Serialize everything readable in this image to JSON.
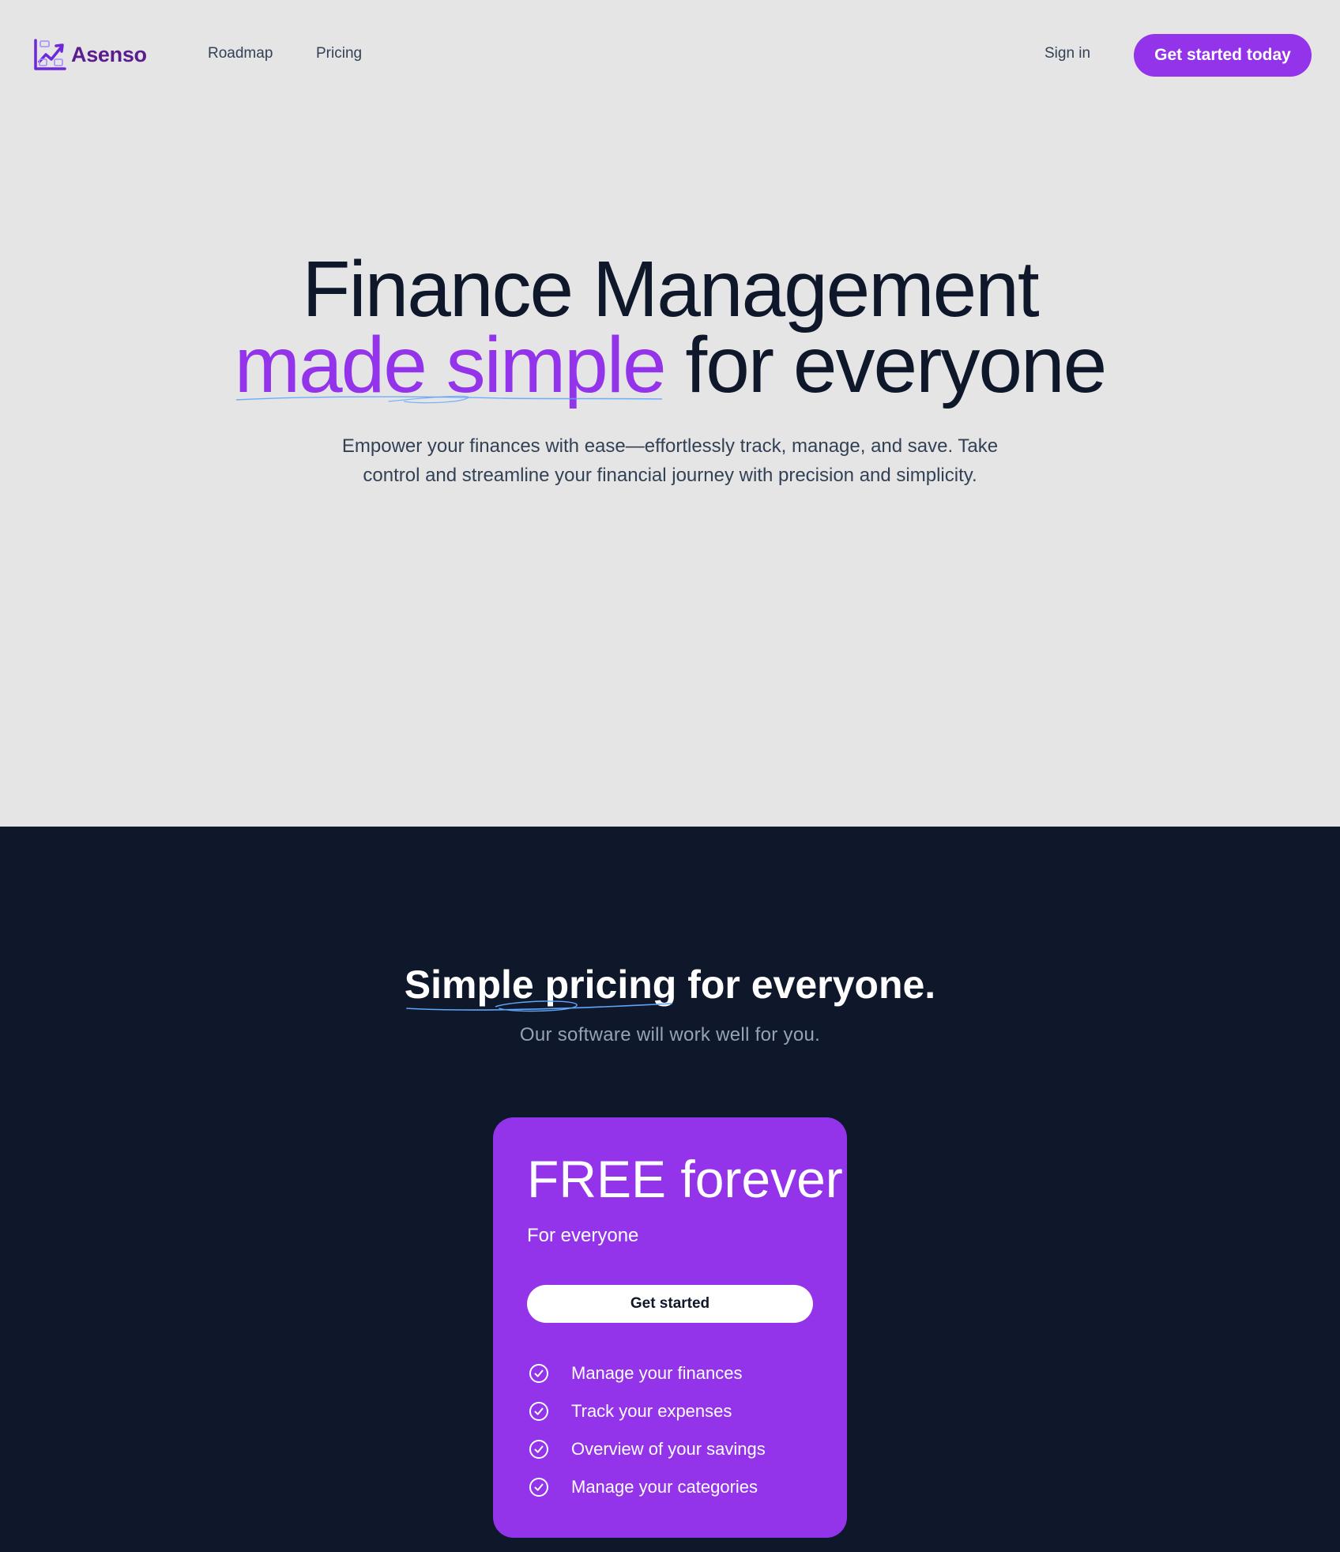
{
  "header": {
    "brand": "Asenso",
    "logo_icon": "chart-growth-icon",
    "nav": {
      "roadmap": "Roadmap",
      "pricing": "Pricing"
    },
    "signin": "Sign in",
    "cta": "Get started today"
  },
  "hero": {
    "title_line1": "Finance Management",
    "title_highlight": "made simple",
    "title_rest": " for everyone",
    "subtitle_line1": "Empower your finances with ease—effortlessly track, manage, and save. Take",
    "subtitle_line2": "control and streamline your financial journey with precision and simplicity."
  },
  "pricing": {
    "title_highlight": "Simple pricing",
    "title_rest": " for everyone.",
    "subtitle": "Our software will work well for you.",
    "plan": {
      "name": "FREE forever",
      "description": "For everyone",
      "button": "Get started",
      "features": [
        "Manage your finances",
        "Track your expenses",
        "Overview of your savings",
        "Manage your categories"
      ],
      "feature_icon": "check-circle-icon"
    }
  },
  "colors": {
    "accent": "#9333ea",
    "brand_text": "#5b1c8d",
    "hero_bg": "#e5e5e6",
    "dark_bg": "#0f172a",
    "underline": "#60a5fa"
  }
}
